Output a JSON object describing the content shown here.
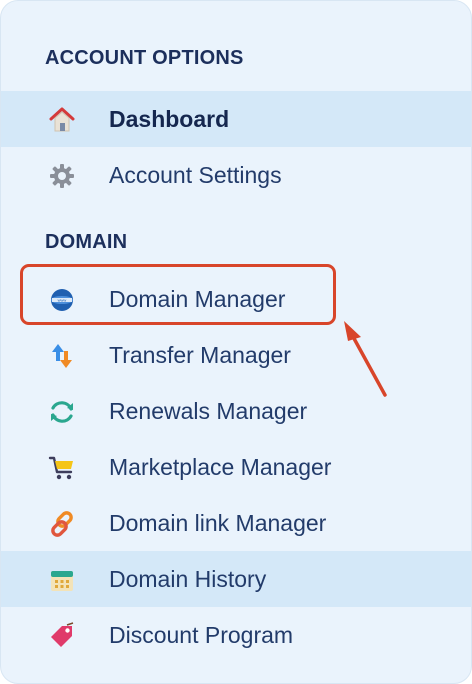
{
  "sections": {
    "account": {
      "title": "ACCOUNT OPTIONS"
    },
    "domain": {
      "title": "DOMAIN"
    }
  },
  "account_items": [
    {
      "label": "Dashboard",
      "icon": "home-icon"
    },
    {
      "label": "Account Settings",
      "icon": "gear-icon"
    }
  ],
  "domain_items": [
    {
      "label": "Domain Manager",
      "icon": "globe-icon"
    },
    {
      "label": "Transfer Manager",
      "icon": "transfer-icon"
    },
    {
      "label": "Renewals Manager",
      "icon": "renew-icon"
    },
    {
      "label": "Marketplace Manager",
      "icon": "cart-icon"
    },
    {
      "label": "Domain link Manager",
      "icon": "link-icon"
    },
    {
      "label": "Domain History",
      "icon": "calendar-icon"
    },
    {
      "label": "Discount Program",
      "icon": "tag-icon"
    }
  ],
  "colors": {
    "panel_bg": "#eaf3fc",
    "active_bg": "#d4e8f8",
    "text": "#223b6a",
    "annotation": "#d8452a"
  }
}
